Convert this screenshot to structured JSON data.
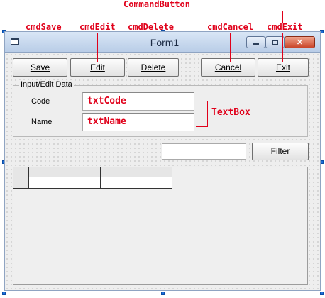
{
  "annotations": {
    "group_label": "CommandButton",
    "cmd_save": "cmdSave",
    "cmd_edit": "cmdEdit",
    "cmd_delete": "cmdDelete",
    "cmd_cancel": "cmdCancel",
    "cmd_exit": "cmdExit",
    "textbox_label": "TextBox",
    "txt_code": "txtCode",
    "txt_name": "txtName"
  },
  "window": {
    "title": "Form1"
  },
  "toolbar": {
    "save_label": "Save",
    "edit_label": "Edit",
    "delete_label": "Delete",
    "cancel_label": "Cancel",
    "exit_label": "Exit"
  },
  "frame": {
    "caption": "Input/Edit Data",
    "code_label": "Code",
    "name_label": "Name"
  },
  "filter": {
    "button_label": "Filter",
    "value": ""
  },
  "colors": {
    "annotation": "#e0001a",
    "selection_handle": "#1e6fd9"
  },
  "icons": [
    "window-form-icon",
    "minimize-icon",
    "maximize-icon",
    "close-icon"
  ]
}
